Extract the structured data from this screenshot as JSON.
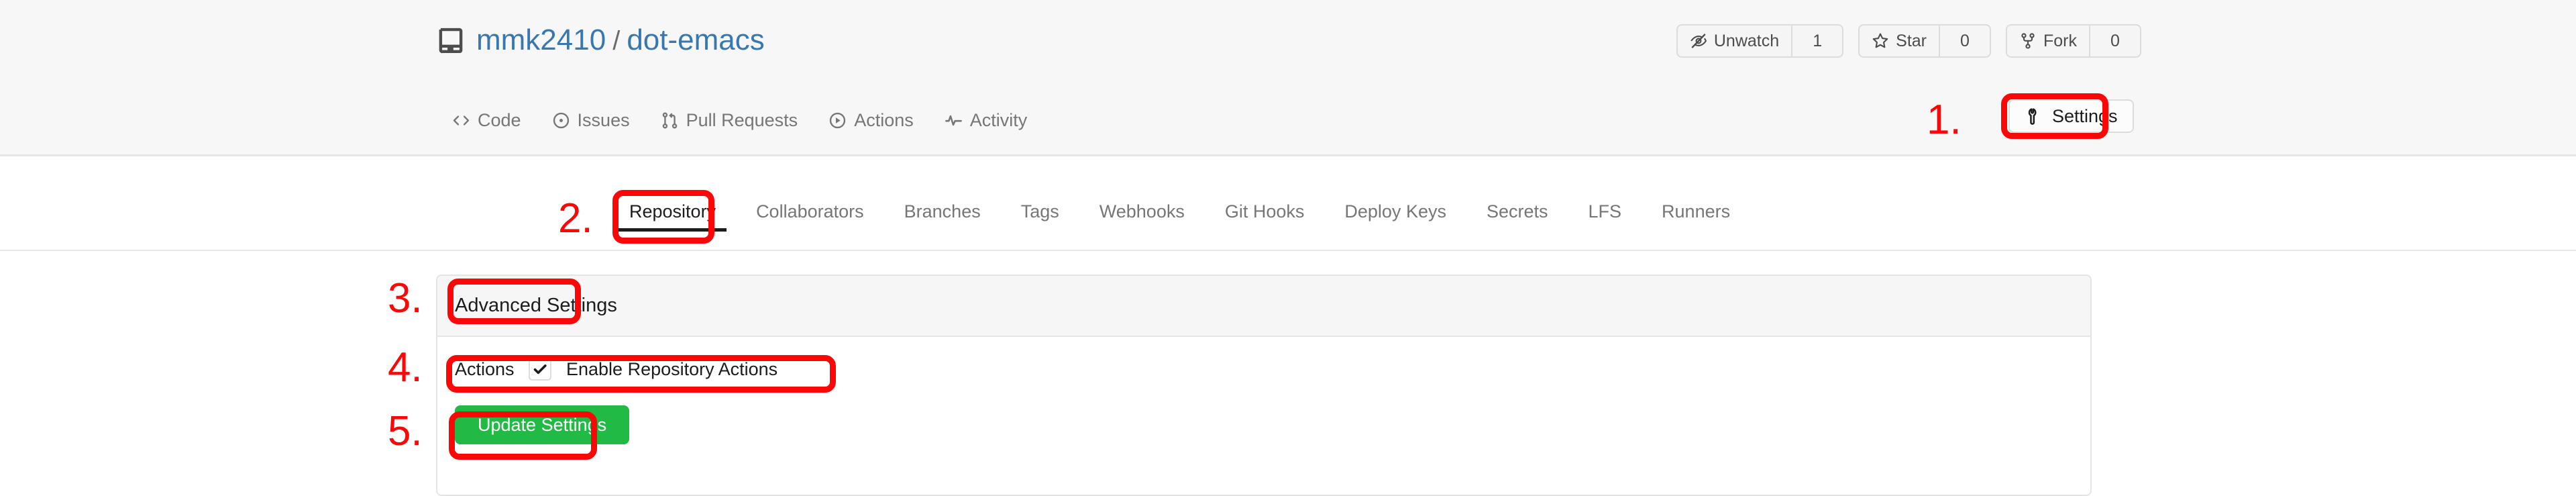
{
  "page": {
    "app": "Gitea repository settings",
    "accent_red": "#fb0707",
    "accent_green": "#21ba45",
    "link_blue": "#3778b1",
    "header_bg": "#f7f7f8"
  },
  "header": {
    "repo_icon": "repo-icon",
    "owner": "mmk2410",
    "separator": "/",
    "repo": "dot-emacs",
    "actions": [
      {
        "icon": "eye-closed-icon",
        "label": "Unwatch",
        "count": "1"
      },
      {
        "icon": "star-icon",
        "label": "Star",
        "count": "0"
      },
      {
        "icon": "fork-icon",
        "label": "Fork",
        "count": "0"
      }
    ],
    "nav": [
      {
        "icon": "code-icon",
        "label": "Code"
      },
      {
        "icon": "issue-opened-icon",
        "label": "Issues"
      },
      {
        "icon": "git-pull-request-icon",
        "label": "Pull Requests"
      },
      {
        "icon": "play-circle-icon",
        "label": "Actions"
      },
      {
        "icon": "pulse-icon",
        "label": "Activity"
      }
    ],
    "settings_button": {
      "icon": "wrench-icon",
      "label": "Settings"
    }
  },
  "settings_tabs": [
    {
      "label": "Repository",
      "active": true
    },
    {
      "label": "Collaborators",
      "active": false
    },
    {
      "label": "Branches",
      "active": false
    },
    {
      "label": "Tags",
      "active": false
    },
    {
      "label": "Webhooks",
      "active": false
    },
    {
      "label": "Git Hooks",
      "active": false
    },
    {
      "label": "Deploy Keys",
      "active": false
    },
    {
      "label": "Secrets",
      "active": false
    },
    {
      "label": "LFS",
      "active": false
    },
    {
      "label": "Runners",
      "active": false
    }
  ],
  "panel": {
    "title": "Advanced Settings",
    "actions_row": {
      "label": "Actions",
      "checkbox_checked": true,
      "checkbox_label": "Enable Repository Actions"
    },
    "submit_label": "Update Settings"
  },
  "annotations": [
    {
      "number": "1.",
      "target": "settings-button"
    },
    {
      "number": "2.",
      "target": "repository-tab"
    },
    {
      "number": "3.",
      "target": "advanced-settings-header"
    },
    {
      "number": "4.",
      "target": "enable-repository-actions-row"
    },
    {
      "number": "5.",
      "target": "update-settings-button"
    }
  ]
}
